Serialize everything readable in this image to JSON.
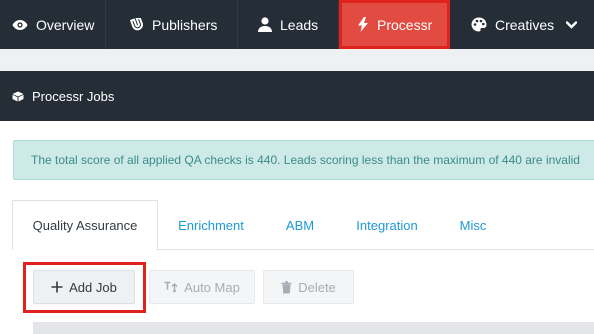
{
  "nav": {
    "items": [
      {
        "label": "Overview",
        "icon": "eye-icon"
      },
      {
        "label": "Publishers",
        "icon": "magnet-icon"
      },
      {
        "label": "Leads",
        "icon": "user-icon"
      },
      {
        "label": "Processr",
        "icon": "bolt-icon",
        "active": true
      },
      {
        "label": "Creatives",
        "icon": "palette-icon",
        "icon_right": "chevron-down-icon"
      }
    ]
  },
  "section": {
    "title": "Processr Jobs",
    "icon": "cubes-icon"
  },
  "alert": {
    "text": "The total score of all applied QA checks is 440. Leads scoring less than the maximum of 440 are invalid"
  },
  "tabs": [
    {
      "label": "Quality Assurance",
      "active": true
    },
    {
      "label": "Enrichment"
    },
    {
      "label": "ABM"
    },
    {
      "label": "Integration"
    },
    {
      "label": "Misc"
    }
  ],
  "toolbar": {
    "add_label": "Add Job",
    "automap_label": "Auto Map",
    "delete_label": "Delete"
  },
  "colors": {
    "nav_bg": "#252d37",
    "active_nav": "#e24b41",
    "highlight": "#e0221d",
    "alert_bg": "#cde9e8",
    "alert_text": "#3b8c88",
    "link": "#1e9ad6"
  }
}
